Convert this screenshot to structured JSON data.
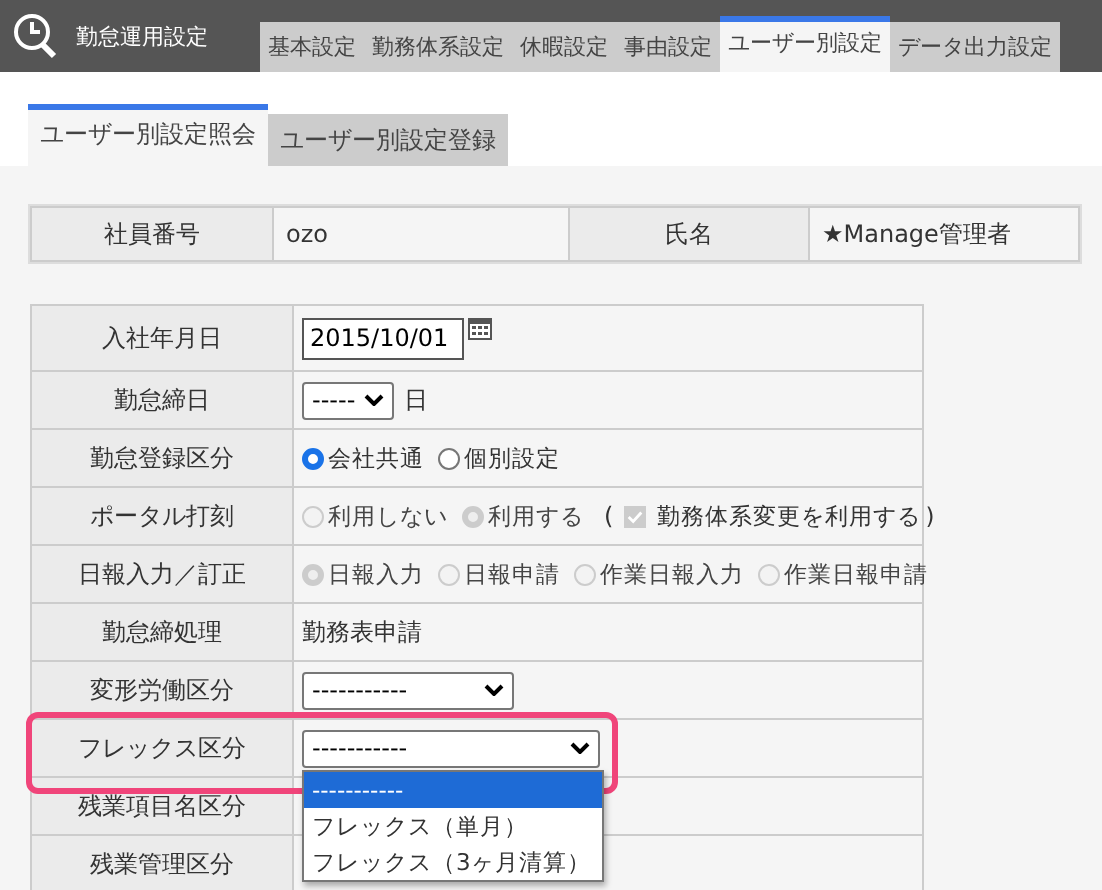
{
  "app": {
    "title": "勤怠運用設定"
  },
  "tabs": [
    {
      "label": "基本設定",
      "selected": false
    },
    {
      "label": "勤務体系設定",
      "selected": false
    },
    {
      "label": "休暇設定",
      "selected": false
    },
    {
      "label": "事由設定",
      "selected": false
    },
    {
      "label": "ユーザー別設定",
      "selected": true
    },
    {
      "label": "データ出力設定",
      "selected": false
    }
  ],
  "subtabs": [
    {
      "label": "ユーザー別設定照会",
      "selected": true
    },
    {
      "label": "ユーザー別設定登録",
      "selected": false
    }
  ],
  "info": [
    {
      "label": "社員番号",
      "value": "ozo"
    },
    {
      "label": "氏名",
      "value": "★Manage管理者"
    }
  ],
  "rows": [
    {
      "kind": "date",
      "label": "入社年月日",
      "value": "2015/10/01"
    },
    {
      "kind": "select",
      "label": "勤怠締日",
      "value": "-----",
      "suffix": "日"
    },
    {
      "kind": "radio",
      "label": "勤怠登録区分",
      "options": [
        {
          "label": "会社共通",
          "selected": true,
          "disabled": false
        },
        {
          "label": "個別設定",
          "selected": false,
          "disabled": false
        }
      ]
    },
    {
      "kind": "radio",
      "label": "ポータル打刻",
      "options": [
        {
          "label": "利用しない",
          "selected": false,
          "disabled": true
        },
        {
          "label": "利用する",
          "selected": true,
          "disabled": true
        }
      ],
      "check": {
        "open": "(",
        "label": "勤務体系変更を利用する",
        "close": ")",
        "checked": true,
        "disabled": true
      }
    },
    {
      "kind": "radio",
      "label": "日報入力／訂正",
      "options": [
        {
          "label": "日報入力",
          "selected": true,
          "disabled": true
        },
        {
          "label": "日報申請",
          "selected": false,
          "disabled": true
        },
        {
          "label": "作業日報入力",
          "selected": false,
          "disabled": true
        },
        {
          "label": "作業日報申請",
          "selected": false,
          "disabled": true
        }
      ]
    },
    {
      "kind": "text",
      "label": "勤怠締処理",
      "value": "勤務表申請"
    },
    {
      "kind": "select",
      "label": "変形労働区分",
      "value": "-----------"
    },
    {
      "kind": "select",
      "label": "フレックス区分",
      "value": "-----------",
      "open": true,
      "options": [
        {
          "label": "-----------",
          "selected": true
        },
        {
          "label": "フレックス（単月）",
          "selected": false
        },
        {
          "label": "フレックス（3ヶ月清算）",
          "selected": false
        }
      ]
    },
    {
      "kind": "empty",
      "label": "残業項目名区分"
    },
    {
      "kind": "empty",
      "label": "残業管理区分"
    }
  ]
}
